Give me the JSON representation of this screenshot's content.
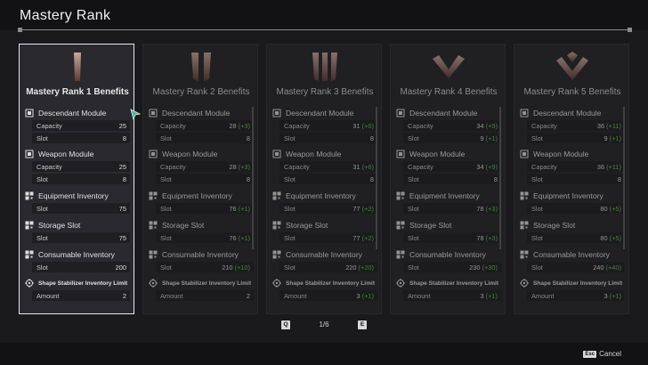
{
  "window": {
    "title": "Mastery Rank"
  },
  "icons": {
    "module": "module-icon",
    "inventory": "inventory-grid-icon",
    "stabilizer": "shape-stabilizer-icon"
  },
  "colors": {
    "bonus": "#5fbf55",
    "selected_border": "#e8e8e8"
  },
  "cards": [
    {
      "title": "Mastery Rank 1 Benefits",
      "emblem": "rank-1-emblem",
      "selected": true,
      "sections": [
        {
          "label": "Descendant Module",
          "rows": [
            {
              "label": "Capacity",
              "value": "25",
              "bonus": ""
            },
            {
              "label": "Slot",
              "value": "8",
              "bonus": ""
            }
          ]
        },
        {
          "label": "Weapon Module",
          "rows": [
            {
              "label": "Capacity",
              "value": "25",
              "bonus": ""
            },
            {
              "label": "Slot",
              "value": "8",
              "bonus": ""
            }
          ]
        },
        {
          "label": "Equipment Inventory",
          "rows": [
            {
              "label": "Slot",
              "value": "75",
              "bonus": ""
            }
          ]
        },
        {
          "label": "Storage Slot",
          "rows": [
            {
              "label": "Slot",
              "value": "75",
              "bonus": ""
            }
          ]
        },
        {
          "label": "Consumable Inventory",
          "rows": [
            {
              "label": "Slot",
              "value": "200",
              "bonus": ""
            }
          ]
        },
        {
          "label": "Shape Stabilizer Inventory Limit",
          "rows": [
            {
              "label": "Amount",
              "value": "2",
              "bonus": ""
            }
          ]
        }
      ]
    },
    {
      "title": "Mastery Rank 2 Benefits",
      "emblem": "rank-2-emblem",
      "selected": false,
      "sections": [
        {
          "label": "Descendant Module",
          "rows": [
            {
              "label": "Capacity",
              "value": "28",
              "bonus": "(+3)"
            },
            {
              "label": "Slot",
              "value": "8",
              "bonus": ""
            }
          ]
        },
        {
          "label": "Weapon Module",
          "rows": [
            {
              "label": "Capacity",
              "value": "28",
              "bonus": "(+3)"
            },
            {
              "label": "Slot",
              "value": "8",
              "bonus": ""
            }
          ]
        },
        {
          "label": "Equipment Inventory",
          "rows": [
            {
              "label": "Slot",
              "value": "76",
              "bonus": "(+1)"
            }
          ]
        },
        {
          "label": "Storage Slot",
          "rows": [
            {
              "label": "Slot",
              "value": "76",
              "bonus": "(+1)"
            }
          ]
        },
        {
          "label": "Consumable Inventory",
          "rows": [
            {
              "label": "Slot",
              "value": "210",
              "bonus": "(+10)"
            }
          ]
        },
        {
          "label": "Shape Stabilizer Inventory Limit",
          "rows": [
            {
              "label": "Amount",
              "value": "2",
              "bonus": ""
            }
          ]
        }
      ]
    },
    {
      "title": "Mastery Rank 3 Benefits",
      "emblem": "rank-3-emblem",
      "selected": false,
      "sections": [
        {
          "label": "Descendant Module",
          "rows": [
            {
              "label": "Capacity",
              "value": "31",
              "bonus": "(+6)"
            },
            {
              "label": "Slot",
              "value": "8",
              "bonus": ""
            }
          ]
        },
        {
          "label": "Weapon Module",
          "rows": [
            {
              "label": "Capacity",
              "value": "31",
              "bonus": "(+6)"
            },
            {
              "label": "Slot",
              "value": "8",
              "bonus": ""
            }
          ]
        },
        {
          "label": "Equipment Inventory",
          "rows": [
            {
              "label": "Slot",
              "value": "77",
              "bonus": "(+2)"
            }
          ]
        },
        {
          "label": "Storage Slot",
          "rows": [
            {
              "label": "Slot",
              "value": "77",
              "bonus": "(+2)"
            }
          ]
        },
        {
          "label": "Consumable Inventory",
          "rows": [
            {
              "label": "Slot",
              "value": "220",
              "bonus": "(+20)"
            }
          ]
        },
        {
          "label": "Shape Stabilizer Inventory Limit",
          "rows": [
            {
              "label": "Amount",
              "value": "3",
              "bonus": "(+1)"
            }
          ]
        }
      ]
    },
    {
      "title": "Mastery Rank 4 Benefits",
      "emblem": "rank-4-emblem",
      "selected": false,
      "sections": [
        {
          "label": "Descendant Module",
          "rows": [
            {
              "label": "Capacity",
              "value": "34",
              "bonus": "(+9)"
            },
            {
              "label": "Slot",
              "value": "9",
              "bonus": "(+1)"
            }
          ]
        },
        {
          "label": "Weapon Module",
          "rows": [
            {
              "label": "Capacity",
              "value": "34",
              "bonus": "(+9)"
            },
            {
              "label": "Slot",
              "value": "8",
              "bonus": ""
            }
          ]
        },
        {
          "label": "Equipment Inventory",
          "rows": [
            {
              "label": "Slot",
              "value": "78",
              "bonus": "(+3)"
            }
          ]
        },
        {
          "label": "Storage Slot",
          "rows": [
            {
              "label": "Slot",
              "value": "78",
              "bonus": "(+3)"
            }
          ]
        },
        {
          "label": "Consumable Inventory",
          "rows": [
            {
              "label": "Slot",
              "value": "230",
              "bonus": "(+30)"
            }
          ]
        },
        {
          "label": "Shape Stabilizer Inventory Limit",
          "rows": [
            {
              "label": "Amount",
              "value": "3",
              "bonus": "(+1)"
            }
          ]
        }
      ]
    },
    {
      "title": "Mastery Rank 5 Benefits",
      "emblem": "rank-5-emblem",
      "selected": false,
      "sections": [
        {
          "label": "Descendant Module",
          "rows": [
            {
              "label": "Capacity",
              "value": "36",
              "bonus": "(+11)"
            },
            {
              "label": "Slot",
              "value": "9",
              "bonus": "(+1)"
            }
          ]
        },
        {
          "label": "Weapon Module",
          "rows": [
            {
              "label": "Capacity",
              "value": "36",
              "bonus": "(+11)"
            },
            {
              "label": "Slot",
              "value": "8",
              "bonus": ""
            }
          ]
        },
        {
          "label": "Equipment Inventory",
          "rows": [
            {
              "label": "Slot",
              "value": "80",
              "bonus": "(+5)"
            }
          ]
        },
        {
          "label": "Storage Slot",
          "rows": [
            {
              "label": "Slot",
              "value": "80",
              "bonus": "(+5)"
            }
          ]
        },
        {
          "label": "Consumable Inventory",
          "rows": [
            {
              "label": "Slot",
              "value": "240",
              "bonus": "(+40)"
            }
          ]
        },
        {
          "label": "Shape Stabilizer Inventory Limit",
          "rows": [
            {
              "label": "Amount",
              "value": "3",
              "bonus": "(+1)"
            }
          ]
        }
      ]
    }
  ],
  "pager": {
    "prev_key": "Q",
    "page": "1/6",
    "next_key": "E"
  },
  "footer": {
    "cancel_key": "Esc",
    "cancel_label": "Cancel"
  }
}
